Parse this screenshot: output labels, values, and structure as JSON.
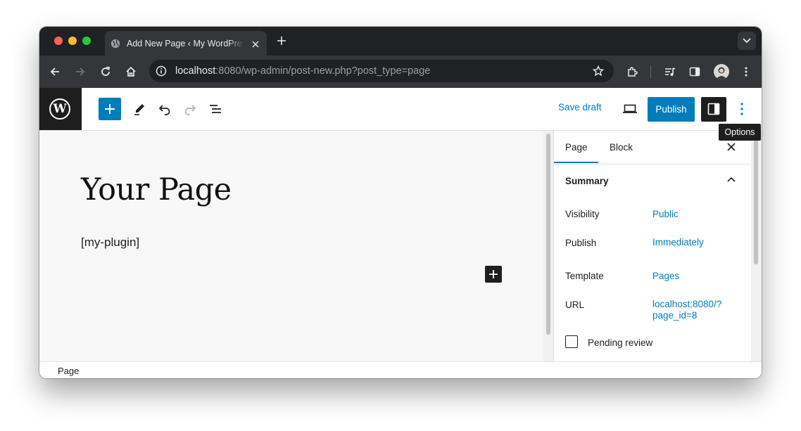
{
  "browser": {
    "tab": {
      "title": "Add New Page ‹ My WordPress",
      "favicon": "globe-icon"
    },
    "address": {
      "host": "localhost",
      "rest": ":8080/wp-admin/post-new.php?post_type=page"
    },
    "icons": [
      "back-icon",
      "forward-icon",
      "reload-icon",
      "home-icon",
      "bookmark-star-icon",
      "extensions-icon",
      "media-icon",
      "side-panel-icon",
      "profile-avatar",
      "kebab-menu-icon"
    ]
  },
  "editor": {
    "logo": "W",
    "header": {
      "save_draft": "Save draft",
      "publish": "Publish",
      "tooltip": "Options"
    },
    "canvas": {
      "title": "Your Page",
      "shortcode": "[my-plugin]"
    },
    "sidebar": {
      "tabs": [
        "Page",
        "Block"
      ],
      "panel_title": "Summary",
      "rows": [
        {
          "label": "Visibility",
          "value": "Public"
        },
        {
          "label": "Publish",
          "value": "Immediately"
        },
        {
          "label": "Template",
          "value": "Pages"
        },
        {
          "label": "URL",
          "value_line1": "localhost:8080/?",
          "value_line2": "page_id=8"
        }
      ],
      "pending_review": "Pending review"
    },
    "footer": {
      "breadcrumb": "Page"
    },
    "colors": {
      "accent": "#007cba",
      "dark": "#1e1e1e"
    }
  }
}
